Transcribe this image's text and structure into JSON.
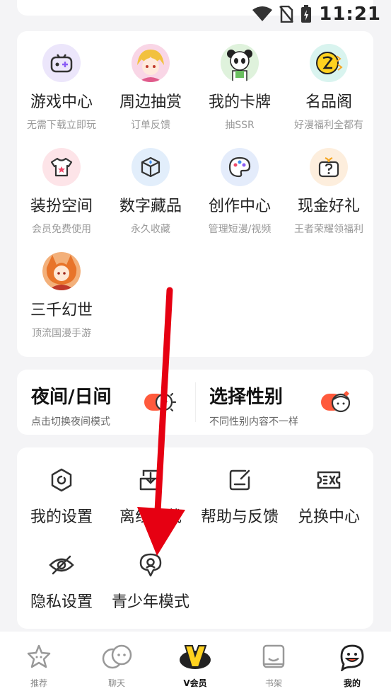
{
  "status_bar": {
    "time": "11:21"
  },
  "services": [
    {
      "title": "游戏中心",
      "subtitle": "无需下载立即玩",
      "icon": "gamepad-icon"
    },
    {
      "title": "周边抽赏",
      "subtitle": "订单反馈",
      "icon": "anime-avatar-icon"
    },
    {
      "title": "我的卡牌",
      "subtitle": "抽SSR",
      "icon": "panda-avatar-icon"
    },
    {
      "title": "名品阁",
      "subtitle": "好漫福利全都有",
      "icon": "brand-icon"
    },
    {
      "title": "装扮空间",
      "subtitle": "会员免费使用",
      "icon": "tshirt-icon"
    },
    {
      "title": "数字藏品",
      "subtitle": "永久收藏",
      "icon": "cube-icon"
    },
    {
      "title": "创作中心",
      "subtitle": "管理短漫/视频",
      "icon": "palette-icon"
    },
    {
      "title": "现金好礼",
      "subtitle": "王者荣耀领福利",
      "icon": "gift-question-icon"
    },
    {
      "title": "三千幻世",
      "subtitle": "顶流国漫手游",
      "icon": "fox-girl-avatar-icon"
    }
  ],
  "toggles": {
    "night": {
      "title": "夜间/日间",
      "subtitle": "点击切换夜间模式"
    },
    "gender": {
      "title": "选择性别",
      "subtitle": "不同性别内容不一样"
    }
  },
  "tools": [
    {
      "label": "我的设置",
      "icon": "settings-icon"
    },
    {
      "label": "离线下载",
      "icon": "download-icon"
    },
    {
      "label": "帮助与反馈",
      "icon": "feedback-icon"
    },
    {
      "label": "兑换中心",
      "icon": "ticket-icon"
    },
    {
      "label": "隐私设置",
      "icon": "eye-off-icon"
    },
    {
      "label": "青少年模式",
      "icon": "teen-mode-icon"
    }
  ],
  "bottom_nav": [
    {
      "label": "推荐",
      "icon": "star-icon"
    },
    {
      "label": "聊天",
      "icon": "chat-icon"
    },
    {
      "label": "V会员",
      "icon": "vip-icon"
    },
    {
      "label": "书架",
      "icon": "bookshelf-icon"
    },
    {
      "label": "我的",
      "icon": "profile-icon"
    }
  ],
  "colors": {
    "accent": "#ff5a3c",
    "vip": "#ffd21f",
    "annotation_arrow": "#e60012"
  }
}
